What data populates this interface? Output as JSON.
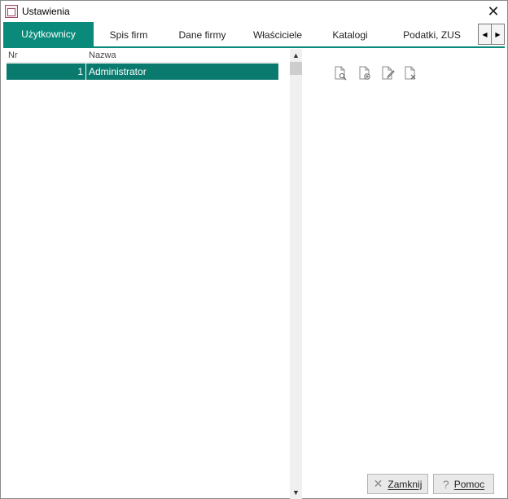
{
  "window": {
    "title": "Ustawienia"
  },
  "tabs": [
    {
      "label": "Użytkownicy"
    },
    {
      "label": "Spis firm"
    },
    {
      "label": "Dane firmy"
    },
    {
      "label": "Właściciele"
    },
    {
      "label": "Katalogi"
    },
    {
      "label": "Podatki, ZUS"
    }
  ],
  "active_tab": "Użytkownicy",
  "colors": {
    "accent": "#0a8a7a",
    "selected_row": "#0a7a6e"
  },
  "grid": {
    "columns": [
      "Nr",
      "Nazwa"
    ],
    "rows": [
      {
        "nr": "1",
        "name": "Administrator"
      }
    ]
  },
  "toolbar": {
    "icons": [
      "view-document-icon",
      "add-document-icon",
      "edit-document-icon",
      "delete-document-icon"
    ]
  },
  "buttons": {
    "close": "Zamknij",
    "help": "Pomoc"
  }
}
